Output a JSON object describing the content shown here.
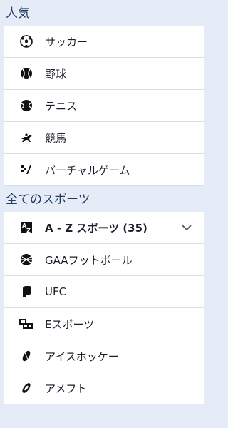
{
  "popular": {
    "title": "人気",
    "items": [
      {
        "label": "サッカー",
        "icon": "soccer-ball-icon"
      },
      {
        "label": "野球",
        "icon": "baseball-icon"
      },
      {
        "label": "テニス",
        "icon": "tennis-ball-icon"
      },
      {
        "label": "競馬",
        "icon": "horse-racing-icon"
      },
      {
        "label": "バーチャルゲーム",
        "icon": "virtual-games-icon"
      }
    ]
  },
  "all_sports": {
    "title": "全てのスポーツ",
    "az": {
      "label": "A - Z スポーツ (35)",
      "icon": "a-z-icon"
    },
    "items": [
      {
        "label": "GAAフットボール",
        "icon": "gaa-ball-icon"
      },
      {
        "label": "UFC",
        "icon": "ufc-glove-icon"
      },
      {
        "label": "Eスポーツ",
        "icon": "esports-icon"
      },
      {
        "label": "アイスホッケー",
        "icon": "ice-hockey-icon"
      },
      {
        "label": "アメフト",
        "icon": "american-football-icon"
      }
    ]
  }
}
